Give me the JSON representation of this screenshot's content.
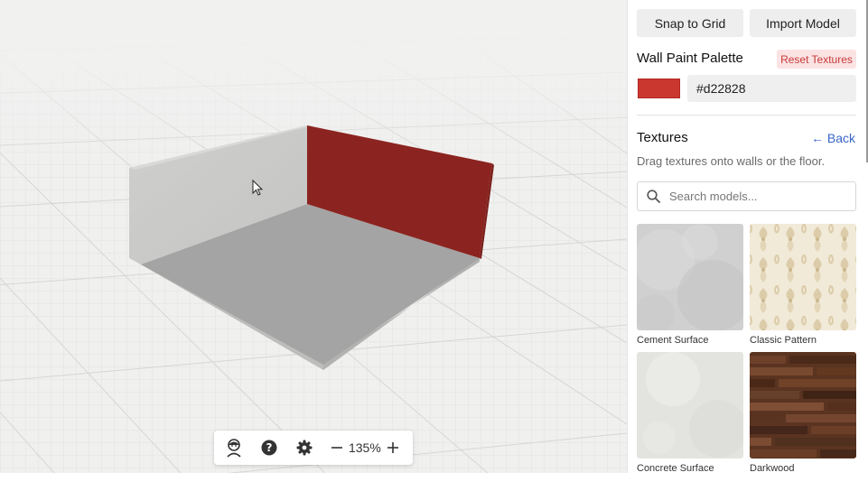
{
  "viewport": {
    "toolbar": {
      "avatar_icon": "person-avatar-icon",
      "help_icon": "help-circle-icon",
      "settings_icon": "gear-icon",
      "zoom_out_icon": "minus-icon",
      "zoom_in_icon": "plus-icon",
      "zoom_value": "135%"
    },
    "scene": {
      "accent_wall_color": "#8b2420",
      "floor_color": "#a4a4a4",
      "wall_color": "#c9c9c7"
    }
  },
  "panel": {
    "snap_label": "Snap to Grid",
    "import_label": "Import Model",
    "palette": {
      "title": "Wall Paint Palette",
      "reset_label": "Reset Textures",
      "swatch_color": "#c9372f",
      "hex_value": "#d22828"
    },
    "textures": {
      "title": "Textures",
      "back_label": "← Back",
      "hint": "Drag textures onto walls or the floor.",
      "search_placeholder": "Search models...",
      "items": [
        {
          "label": "Cement Surface"
        },
        {
          "label": "Classic Pattern"
        },
        {
          "label": "Concrete Surface"
        },
        {
          "label": "Darkwood"
        }
      ]
    }
  }
}
